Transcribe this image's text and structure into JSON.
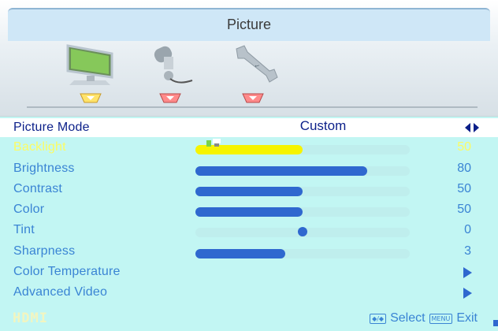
{
  "header": {
    "title": "Picture",
    "tabs": [
      {
        "icon": "monitor-icon",
        "active": true
      },
      {
        "icon": "microphone-icon",
        "active": false
      },
      {
        "icon": "wrench-icon",
        "active": false
      }
    ]
  },
  "picture_mode": {
    "label": "Picture Mode",
    "value": "Custom"
  },
  "settings": [
    {
      "label": "Backlight",
      "value": "50",
      "level": 0.5,
      "faded": true
    },
    {
      "label": "Brightness",
      "value": "80",
      "level": 0.8
    },
    {
      "label": "Contrast",
      "value": "50",
      "level": 0.5
    },
    {
      "label": "Color",
      "value": "50",
      "level": 0.5
    },
    {
      "label": "Tint",
      "value": "0",
      "level": 0.5,
      "type": "knob"
    },
    {
      "label": "Sharpness",
      "value": "3",
      "level": 0.42
    }
  ],
  "submenus": [
    {
      "label": "Color Temperature",
      "icon": "chevron-right-icon"
    },
    {
      "label": "Advanced Video",
      "icon": "chevron-right-icon"
    }
  ],
  "footer": {
    "source": "HDMI",
    "nav_hint": {
      "select_key": "◆/◆",
      "select_label": "Select",
      "exit_key": "MENU",
      "exit_label": "Exit"
    }
  },
  "colors": {
    "background": "#c2f6f3",
    "text": "#3a84d4",
    "bar": "#2f68cf",
    "selected_text": "#0b1f89",
    "faded": "#fcfc63"
  }
}
